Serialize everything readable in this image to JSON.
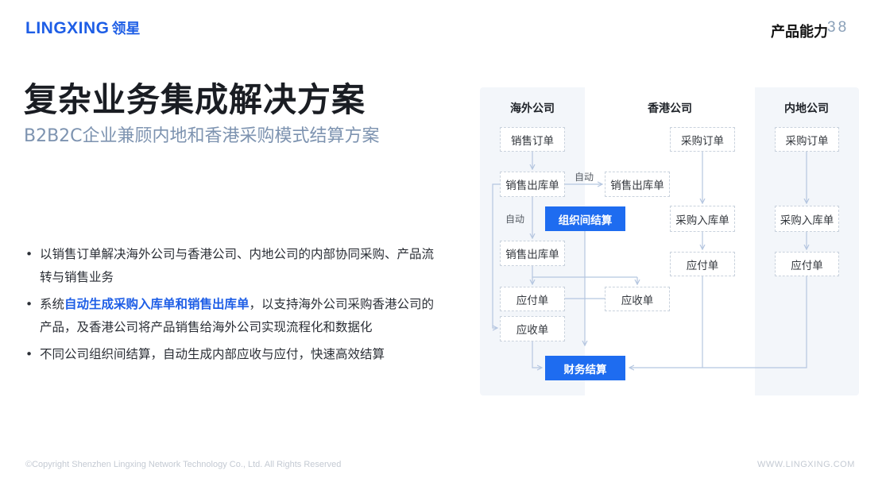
{
  "header": {
    "logo_en": "LINGXING",
    "logo_cn": "领星",
    "section": "产品能力",
    "page_number": "38"
  },
  "title": "复杂业务集成解决方案",
  "subtitle": "B2B2C企业兼顾内地和香港采购模式结算方案",
  "bullets": {
    "b1": "以销售订单解决海外公司与香港公司、内地公司的内部协同采购、产品流转与销售业务",
    "b2_pre": "系统",
    "b2_highlight": "自动生成采购入库单和销售出库单",
    "b2_post": "，以支持海外公司采购香港公司的产品，及香港公司将产品销售给海外公司实现流程化和数据化",
    "b3": "不同公司组织间结算，自动生成内部应收与应付，快速高效结算"
  },
  "diagram": {
    "columns": {
      "overseas": "海外公司",
      "hongkong": "香港公司",
      "mainland": "内地公司"
    },
    "overseas": {
      "sales_order": "销售订单",
      "sales_outbound_1": "销售出库单",
      "sales_outbound_2": "销售出库单",
      "payable": "应付单",
      "receivable": "应收单"
    },
    "hongkong": {
      "sales_outbound": "销售出库单",
      "purchase_order": "采购订单",
      "purchase_inbound": "采购入库单",
      "payable": "应付单",
      "receivable": "应收单"
    },
    "mainland": {
      "purchase_order": "采购订单",
      "purchase_inbound": "采购入库单",
      "payable": "应付单"
    },
    "inter_org_settlement": "组织间结算",
    "financial_settlement": "财务结算",
    "auto_label_1": "自动",
    "auto_label_2": "自动"
  },
  "footer": {
    "copyright": "©Copyright Shenzhen Lingxing Network Technology Co., Ltd. All Rights Reserved",
    "website": "WWW.LINGXING.COM"
  },
  "colors": {
    "brand_blue": "#1e6cf0",
    "subtitle": "#7d93b0"
  }
}
